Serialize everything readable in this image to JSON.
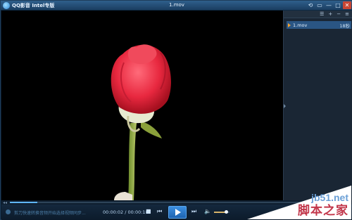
{
  "titlebar": {
    "app_title": "QQ影音  Intel专版",
    "file_title": "1.mov",
    "controls": [
      "⟲",
      "▭",
      "—",
      "□",
      "✕"
    ]
  },
  "playlist": {
    "toolbar_icons": [
      "list-icon",
      "add-icon",
      "remove-icon",
      "more-icon"
    ],
    "items": [
      {
        "name": "1.mov",
        "duration": "18秒"
      }
    ]
  },
  "progress": {
    "position": 0.02
  },
  "controls": {
    "ticker_text": "剪刀快速转换音频开始选择视频同步...",
    "time": "00:00:02 / 00:00:18",
    "volume": 0.8
  },
  "watermark": {
    "site": "jb51.net",
    "name": "脚本之家"
  }
}
